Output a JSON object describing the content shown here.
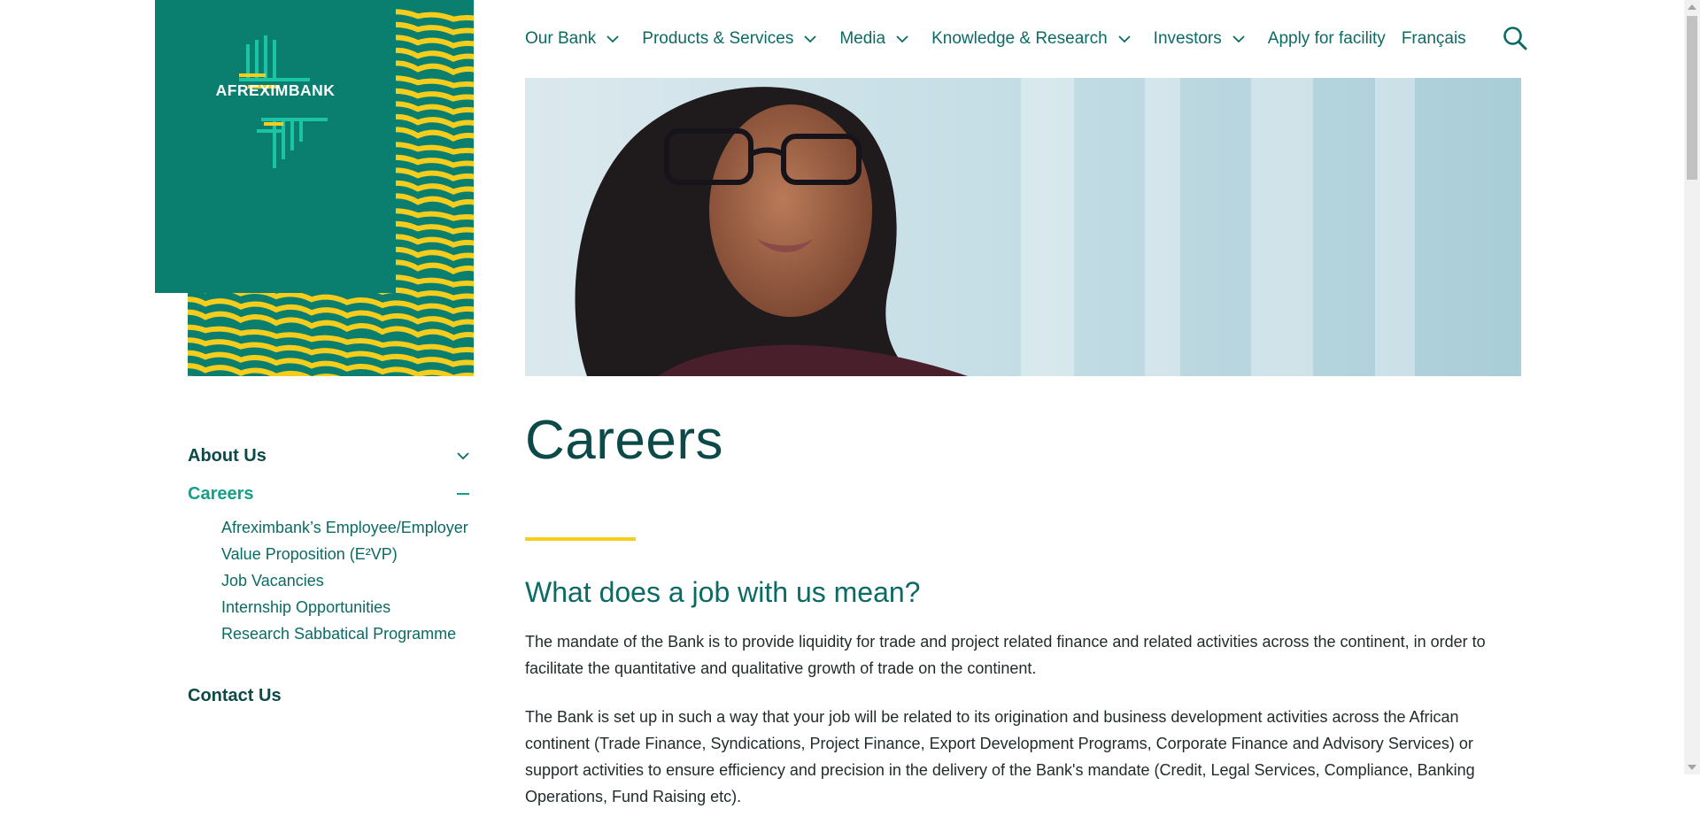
{
  "brand": {
    "name": "AFREXIMBANK",
    "colors": {
      "primary": "#0b7f6f",
      "accent": "#f6cd1c",
      "link": "#0b6b64",
      "heading": "#0b4a48",
      "active": "#13a08a"
    }
  },
  "nav": {
    "items": [
      {
        "label": "Our Bank",
        "has_dropdown": true
      },
      {
        "label": "Products & Services",
        "has_dropdown": true
      },
      {
        "label": "Media",
        "has_dropdown": true
      },
      {
        "label": "Knowledge & Research",
        "has_dropdown": true
      },
      {
        "label": "Investors",
        "has_dropdown": true
      },
      {
        "label": "Apply for facility",
        "has_dropdown": false
      },
      {
        "label": "Français",
        "has_dropdown": false
      }
    ],
    "search_icon": "search-icon"
  },
  "sidebar": {
    "about_label": "About Us",
    "careers_label": "Careers",
    "careers_sub": [
      {
        "line1": "Afreximbank’s Employee/Employer",
        "line2": "Value Proposition (E²VP)"
      },
      {
        "line1": "Job Vacancies"
      },
      {
        "line1": "Internship Opportunities"
      },
      {
        "line1": "Research Sabbatical Programme"
      }
    ],
    "contact_label": "Contact Us"
  },
  "main": {
    "title": "Careers",
    "section_heading": "What does a job with us mean?",
    "paragraphs": [
      "The mandate of the Bank is to provide liquidity for trade and project related finance and related activities across the continent, in order to facilitate the quantitative and qualitative growth of trade on the continent.",
      "The Bank is set up in such a way that your job will be related to its origination and business development activities across the African continent (Trade Finance, Syndications, Project Finance, Export Development Programs, Corporate Finance and Advisory Services) or support activities to ensure efficiency and precision in the delivery of the Bank's mandate (Credit, Legal Services, Compliance, Banking Operations, Fund Raising etc)."
    ]
  }
}
